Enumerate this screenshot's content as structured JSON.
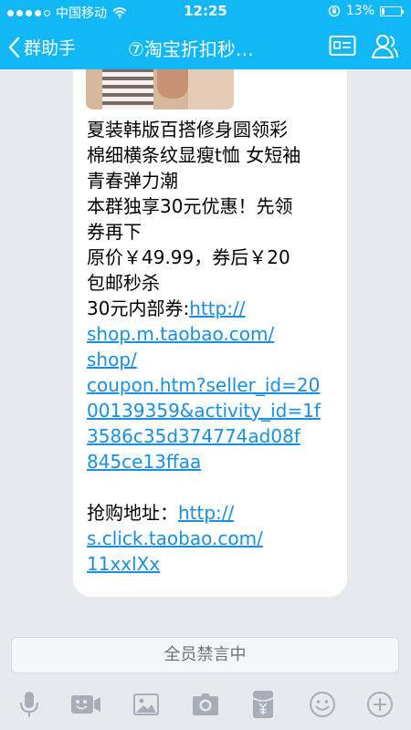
{
  "status_bar": {
    "carrier": "中国移动",
    "time": "12:25",
    "battery": "13%",
    "battery_level": 0.13
  },
  "nav": {
    "back_label": "群助手",
    "title": "⑦淘宝折扣秒…"
  },
  "message": {
    "line1": "夏装韩版百搭修身圆领彩",
    "line2": "棉细横条纹显瘦t恤 女短袖",
    "line3": "青春弹力潮",
    "line4": "本群独享30元优惠！先领",
    "line5": "券再下",
    "line6": "原价￥49.99，券后￥20",
    "line7": "包邮秒杀",
    "coupon_label": "30元内部券:",
    "coupon_url_1": "http://",
    "coupon_url_2": "shop.m.taobao.com/",
    "coupon_url_3": "shop/",
    "coupon_url_4": "coupon.htm?seller_id=20",
    "coupon_url_5": "00139359&activity_id=1f",
    "coupon_url_6": "3586c35d374774ad08f",
    "coupon_url_7": "845ce13ffaa",
    "buy_label": "抢购地址：",
    "buy_url_1": "http://",
    "buy_url_2": "s.click.taobao.com/",
    "buy_url_3": "11xxlXx"
  },
  "mute_bar": {
    "text": "全员禁言中"
  },
  "toolbar": {
    "icons": [
      "microphone-icon",
      "video-icon",
      "image-icon",
      "camera-icon",
      "red-packet-icon",
      "emoji-icon",
      "plus-icon"
    ]
  },
  "colors": {
    "brand_blue": "#12b7f5",
    "link_blue": "#1a8fe0",
    "icon_gray": "#a7aeb8",
    "chat_bg": "#e6e9ee"
  }
}
